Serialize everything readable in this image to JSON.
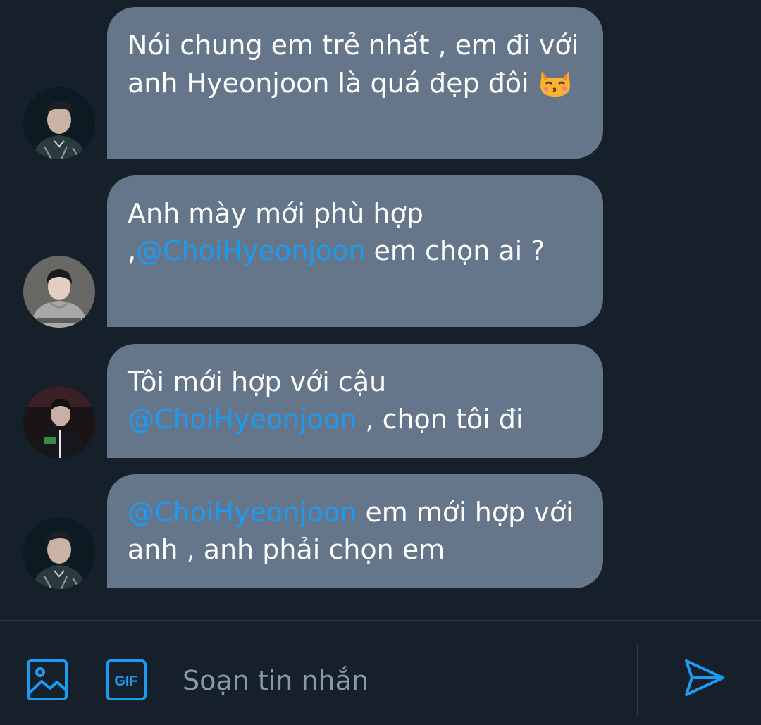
{
  "messages": [
    {
      "avatar": "avatar-player-jersey",
      "parts": [
        {
          "type": "text",
          "text": "Nói chung em trẻ nhất , em đi với anh Hyeonjoon là quá đẹp đôi "
        },
        {
          "type": "emoji",
          "name": "kissing-cat-emoji"
        }
      ]
    },
    {
      "avatar": "avatar-hoodie",
      "parts": [
        {
          "type": "text",
          "text": "Anh mày mới phù hợp ,"
        },
        {
          "type": "mention",
          "text": "@ChoiHyeonjoon"
        },
        {
          "type": "text",
          "text": " em chọn ai ?"
        }
      ]
    },
    {
      "avatar": "avatar-dark-jacket",
      "parts": [
        {
          "type": "text",
          "text": "Tôi mới hợp với cậu "
        },
        {
          "type": "mention",
          "text": "@ChoiHyeonjoon"
        },
        {
          "type": "text",
          "text": " , chọn tôi đi"
        }
      ]
    },
    {
      "avatar": "avatar-player-jersey",
      "parts": [
        {
          "type": "mention",
          "text": "@ChoiHyeonjoon"
        },
        {
          "type": "text",
          "text": " em mới hợp với anh , anh phải chọn em"
        }
      ]
    }
  ],
  "composer": {
    "placeholder": "Soạn tin nhắn",
    "value": "",
    "gif_label": "GIF",
    "media_icon": "image-icon",
    "send_icon": "send-icon"
  },
  "colors": {
    "background": "#15202b",
    "bubble": "#66768a",
    "mention": "#1d9bf0",
    "accent": "#1d9bf0",
    "placeholder": "#8b98a5",
    "divider": "#2f3b47"
  }
}
